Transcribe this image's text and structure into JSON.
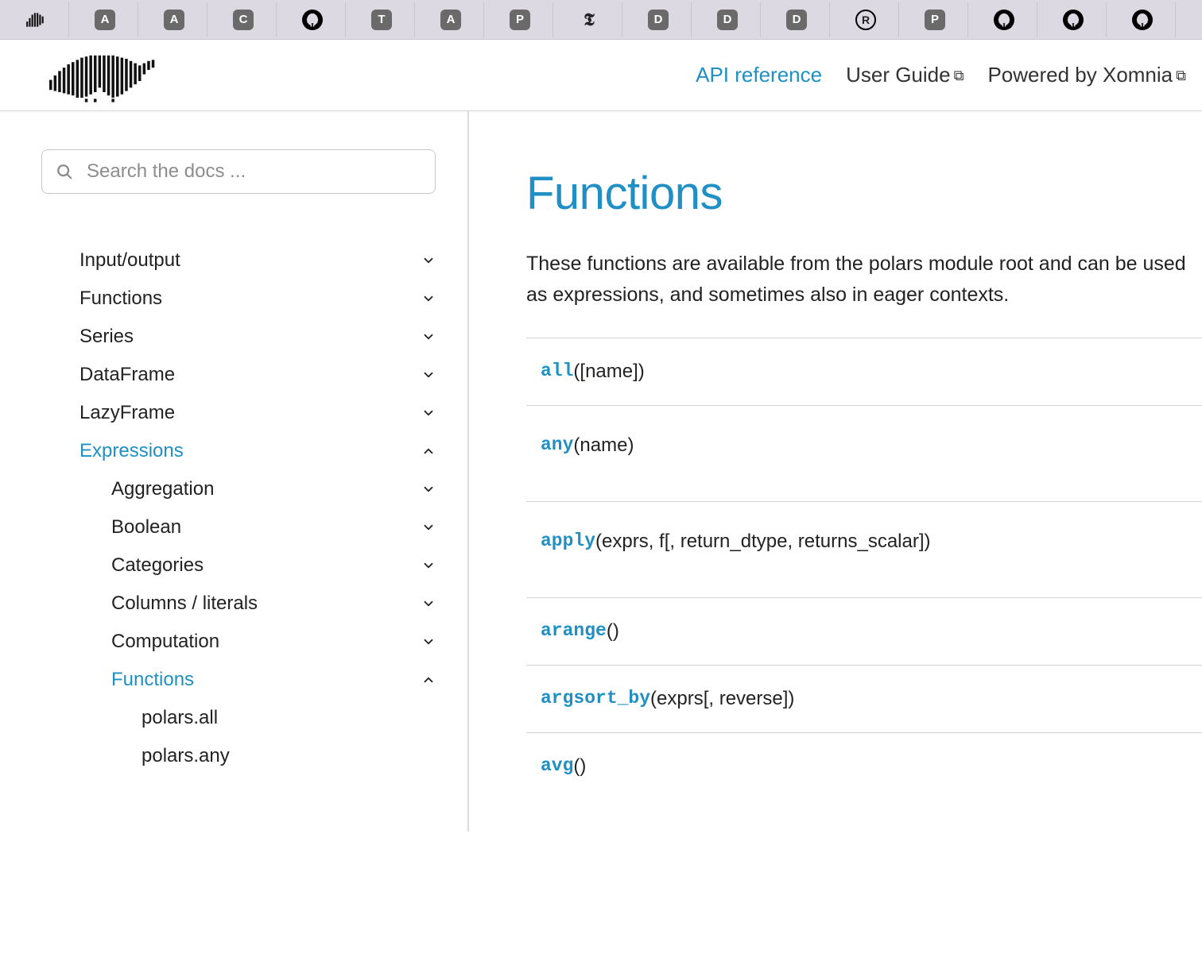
{
  "browser_tabs": [
    {
      "kind": "polars"
    },
    {
      "kind": "sq",
      "letter": "A"
    },
    {
      "kind": "sq",
      "letter": "A"
    },
    {
      "kind": "sq",
      "letter": "C"
    },
    {
      "kind": "gh"
    },
    {
      "kind": "sq",
      "letter": "T"
    },
    {
      "kind": "sq",
      "letter": "A"
    },
    {
      "kind": "sq",
      "letter": "P"
    },
    {
      "kind": "nyt"
    },
    {
      "kind": "sq",
      "letter": "D"
    },
    {
      "kind": "sq",
      "letter": "D"
    },
    {
      "kind": "sq",
      "letter": "D"
    },
    {
      "kind": "rust"
    },
    {
      "kind": "sq",
      "letter": "P"
    },
    {
      "kind": "gh"
    },
    {
      "kind": "gh"
    },
    {
      "kind": "gh"
    }
  ],
  "header": {
    "api_reference": "API reference",
    "user_guide": "User Guide",
    "powered_by": "Powered by Xomnia"
  },
  "search": {
    "placeholder": "Search the docs ..."
  },
  "sidebar": {
    "items": [
      {
        "label": "Input/output",
        "chev": "down",
        "level": 0
      },
      {
        "label": "Functions",
        "chev": "down",
        "level": 0
      },
      {
        "label": "Series",
        "chev": "down",
        "level": 0
      },
      {
        "label": "DataFrame",
        "chev": "down",
        "level": 0
      },
      {
        "label": "LazyFrame",
        "chev": "down",
        "level": 0
      },
      {
        "label": "Expressions",
        "chev": "up",
        "level": 0,
        "active": true
      },
      {
        "label": "Aggregation",
        "chev": "down",
        "level": 1
      },
      {
        "label": "Boolean",
        "chev": "down",
        "level": 1
      },
      {
        "label": "Categories",
        "chev": "down",
        "level": 1
      },
      {
        "label": "Columns / literals",
        "chev": "down",
        "level": 1
      },
      {
        "label": "Computation",
        "chev": "down",
        "level": 1
      },
      {
        "label": "Functions",
        "chev": "up",
        "level": 1,
        "active": true
      },
      {
        "label": "polars.all",
        "chev": "",
        "level": 2
      },
      {
        "label": "polars.any",
        "chev": "",
        "level": 2
      }
    ]
  },
  "page": {
    "title": "Functions",
    "description": "These functions are available from the polars module root and can be used as expressions, and sometimes also in eager contexts."
  },
  "functions": [
    {
      "name": "all",
      "sig": "([name])",
      "tall": false
    },
    {
      "name": "any",
      "sig": "(name)",
      "tall": true
    },
    {
      "name": "apply",
      "sig": "(exprs, f[, return_dtype, returns_scalar])",
      "tall": true
    },
    {
      "name": "arange",
      "sig": "()",
      "tall": false
    },
    {
      "name": "argsort_by",
      "sig": "(exprs[, reverse])",
      "tall": false
    },
    {
      "name": "avg",
      "sig": "()",
      "tall": false
    }
  ]
}
